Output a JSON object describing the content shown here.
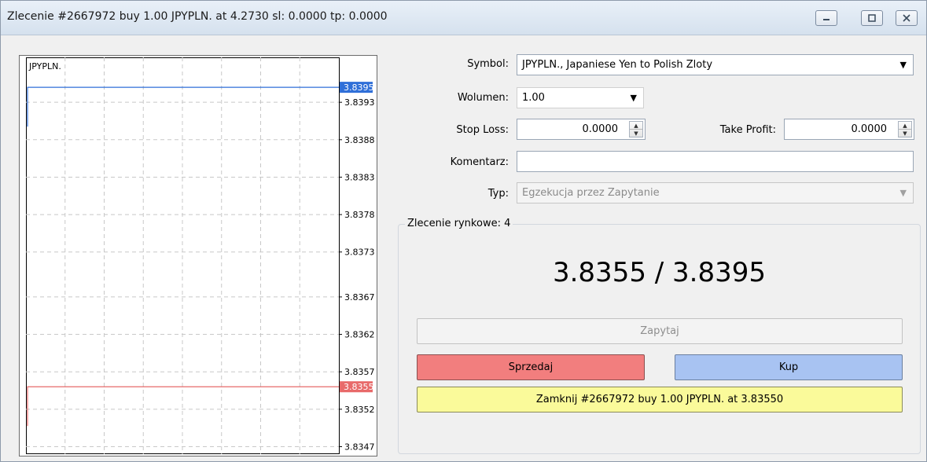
{
  "window": {
    "title": "Zlecenie #2667972 buy 1.00 JPYPLN. at 4.2730 sl: 0.0000 tp: 0.0000",
    "minimize_icon": "minimize-icon",
    "maximize_icon": "maximize-icon",
    "close_icon": "close-icon"
  },
  "chart": {
    "symbol_label": "JPYPLN.",
    "y_ticks": [
      "3.8393",
      "3.8388",
      "3.8383",
      "3.8378",
      "3.8373",
      "3.8367",
      "3.8362",
      "3.8357",
      "3.8352",
      "3.8347"
    ],
    "ask_label": "3.8395",
    "bid_label": "3.8355",
    "ask_color": "#2f6fd8",
    "bid_color": "#e86a6a",
    "ask_value": 3.8395,
    "bid_value": 3.8355,
    "y_range": [
      3.8346,
      3.8399
    ]
  },
  "form": {
    "symbol_label": "Symbol:",
    "symbol_value": "JPYPLN., Japaniese Yen to Polish Zloty",
    "volume_label": "Wolumen:",
    "volume_value": "1.00",
    "stop_loss_label": "Stop Loss:",
    "stop_loss_value": "0.0000",
    "take_profit_label": "Take Profit:",
    "take_profit_value": "0.0000",
    "comment_label": "Komentarz:",
    "comment_value": "",
    "type_label": "Typ:",
    "type_value": "Egzekucja przez Zapytanie"
  },
  "market": {
    "group_title": "Zlecenie rynkowe: 4",
    "price_display": "3.8355 / 3.8395",
    "request_button": "Zapytaj",
    "sell_button": "Sprzedaj",
    "buy_button": "Kup",
    "close_button": "Zamknij #2667972 buy 1.00 JPYPLN. at 3.83550",
    "sell_color": "#f27e7e",
    "buy_color": "#a8c3f2",
    "close_color": "#fafa9a"
  }
}
